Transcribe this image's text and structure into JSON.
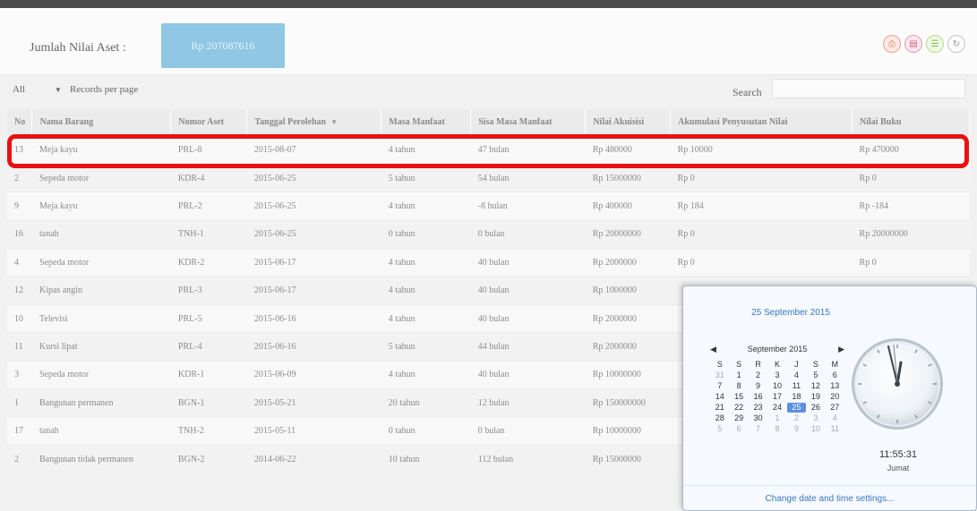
{
  "summary": {
    "label": "Jumlah Nilai Aset :",
    "value": "Rp 207087616"
  },
  "toolbar": {
    "icons": [
      "print-icon",
      "pdf-icon",
      "excel-icon",
      "refresh-icon"
    ]
  },
  "records": {
    "selected": "All",
    "label": "Records per page"
  },
  "search": {
    "label": "Search",
    "placeholder": ""
  },
  "table": {
    "columns": [
      "No",
      "Nama Barang",
      "Nomor Aset",
      "Tanggal Perolehan",
      "Masa Manfaat",
      "Sisa Masa Manfaat",
      "Nilai Akuisisi",
      "Akumulasi Penyusutan Nilai",
      "Nilai Buku"
    ],
    "rows": [
      [
        "13",
        "Meja kayu",
        "PRL-8",
        "2015-08-07",
        "4 tahun",
        "47 bulan",
        "Rp 480000",
        "Rp 10000",
        "Rp 470000"
      ],
      [
        "2",
        "Sepeda motor",
        "KDR-4",
        "2015-06-25",
        "5 tahun",
        "54 bulan",
        "Rp 15000000",
        "Rp 0",
        "Rp 0"
      ],
      [
        "9",
        "Meja kayu",
        "PRL-2",
        "2015-06-25",
        "4 tahun",
        "-8 bulan",
        "Rp 400000",
        "Rp 184",
        "Rp -184"
      ],
      [
        "16",
        "tanah",
        "TNH-1",
        "2015-06-25",
        "0 tahun",
        "0 bulan",
        "Rp 20000000",
        "Rp 0",
        "Rp 20000000"
      ],
      [
        "4",
        "Sepeda motor",
        "KDR-2",
        "2015-06-17",
        "4 tahun",
        "40 bulan",
        "Rp 2000000",
        "Rp 0",
        "Rp 0"
      ],
      [
        "12",
        "Kipas angin",
        "PRL-3",
        "2015-06-17",
        "4 tahun",
        "40 bulan",
        "Rp 1000000",
        "",
        ""
      ],
      [
        "10",
        "Televisi",
        "PRL-5",
        "2015-06-16",
        "4 tahun",
        "40 bulan",
        "Rp 2000000",
        "",
        ""
      ],
      [
        "11",
        "Kursi lipat",
        "PRL-4",
        "2015-06-16",
        "5 tahun",
        "44 bulan",
        "Rp 2000000",
        "",
        ""
      ],
      [
        "3",
        "Sepeda motor",
        "KDR-1",
        "2015-06-09",
        "4 tahun",
        "40 bulan",
        "Rp 10000000",
        "",
        ""
      ],
      [
        "1",
        "Bangunan permanen",
        "BGN-1",
        "2015-05-21",
        "20 tahun",
        "12 bulan",
        "Rp 150000000",
        "",
        ""
      ],
      [
        "17",
        "tanah",
        "TNH-2",
        "2015-05-11",
        "0 tahun",
        "0 bulan",
        "Rp 10000000",
        "",
        ""
      ],
      [
        "2",
        "Bangunan tidak permanen",
        "BGN-2",
        "2014-06-22",
        "10 tahun",
        "112 bulan",
        "Rp 15000000",
        "",
        ""
      ]
    ]
  },
  "clock": {
    "date_title": "25 September 2015",
    "month": "September 2015",
    "weekdays": [
      "S",
      "S",
      "R",
      "K",
      "J",
      "S",
      "M"
    ],
    "days": [
      [
        "31",
        "1",
        "2",
        "3",
        "4",
        "5",
        "6"
      ],
      [
        "7",
        "8",
        "9",
        "10",
        "11",
        "12",
        "13"
      ],
      [
        "14",
        "15",
        "16",
        "17",
        "18",
        "19",
        "20"
      ],
      [
        "21",
        "22",
        "23",
        "24",
        "25",
        "26",
        "27"
      ],
      [
        "28",
        "29",
        "30",
        "1",
        "2",
        "3",
        "4"
      ],
      [
        "5",
        "6",
        "7",
        "8",
        "9",
        "10",
        "11"
      ]
    ],
    "selected_day": "25",
    "time": "11:55:31",
    "day_name": "Jumat",
    "link": "Change date and time settings..."
  }
}
